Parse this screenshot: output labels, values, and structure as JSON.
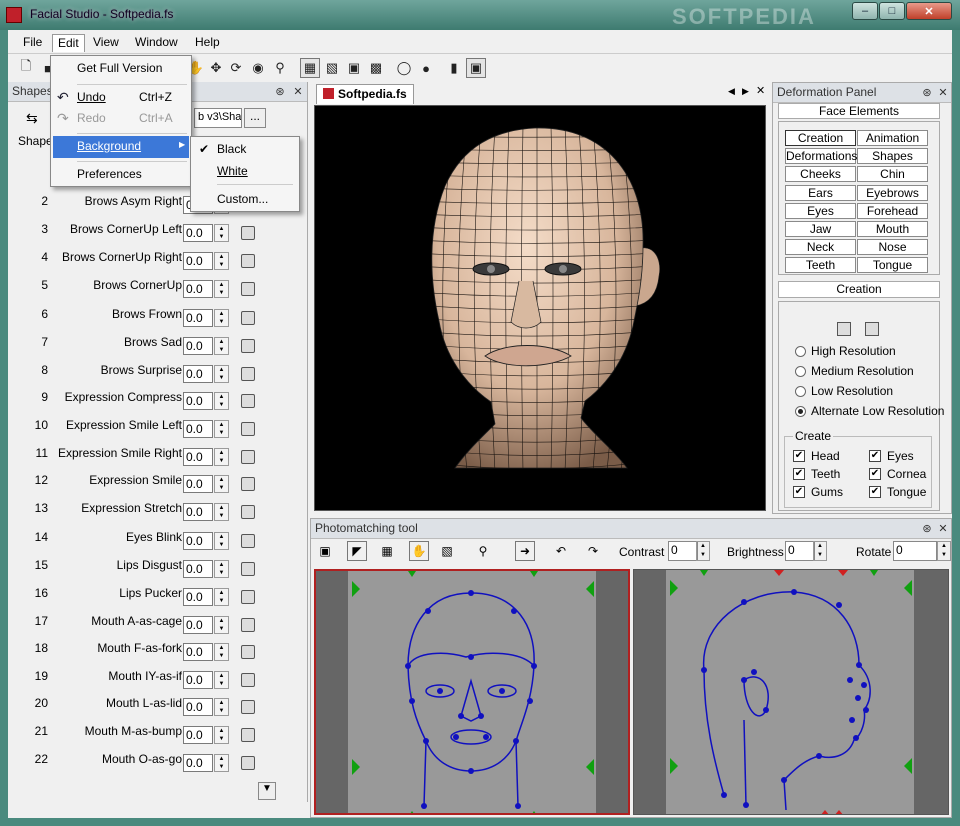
{
  "window": {
    "title": "Facial Studio - Softpedia.fs",
    "watermark": "SOFTPEDIA"
  },
  "menubar": [
    "File",
    "Edit",
    "View",
    "Window",
    "Help"
  ],
  "edit_menu": {
    "items": [
      {
        "label": "Get Full Version",
        "shortcut": "",
        "enabled": true
      },
      {
        "label": "Undo",
        "shortcut": "Ctrl+Z",
        "enabled": true
      },
      {
        "label": "Redo",
        "shortcut": "Ctrl+A",
        "enabled": false
      },
      {
        "label": "Background",
        "shortcut": "",
        "enabled": true,
        "highlighted": true
      },
      {
        "label": "Preferences",
        "shortcut": "",
        "enabled": true
      }
    ],
    "background_submenu": [
      {
        "label": "Black",
        "checked": true
      },
      {
        "label": "White",
        "checked": false
      },
      {
        "label": "Custom...",
        "checked": false
      }
    ]
  },
  "shapes_panel": {
    "title": "Shapes",
    "shape_label": "Shape",
    "path_value": "b v3\\Sha",
    "browse_label": "...",
    "rows": [
      {
        "num": "2",
        "name": "Brows Asym Right",
        "value": "0.0"
      },
      {
        "num": "3",
        "name": "Brows CornerUp Left",
        "value": "0.0"
      },
      {
        "num": "4",
        "name": "Brows CornerUp Right",
        "value": "0.0"
      },
      {
        "num": "5",
        "name": "Brows CornerUp",
        "value": "0.0"
      },
      {
        "num": "6",
        "name": "Brows Frown",
        "value": "0.0"
      },
      {
        "num": "7",
        "name": "Brows Sad",
        "value": "0.0"
      },
      {
        "num": "8",
        "name": "Brows Surprise",
        "value": "0.0"
      },
      {
        "num": "9",
        "name": "Expression Compress",
        "value": "0.0"
      },
      {
        "num": "10",
        "name": "Expression Smile Left",
        "value": "0.0"
      },
      {
        "num": "11",
        "name": "Expression Smile Right",
        "value": "0.0"
      },
      {
        "num": "12",
        "name": "Expression Smile",
        "value": "0.0"
      },
      {
        "num": "13",
        "name": "Expression Stretch",
        "value": "0.0"
      },
      {
        "num": "14",
        "name": "Eyes Blink",
        "value": "0.0"
      },
      {
        "num": "15",
        "name": "Lips Disgust",
        "value": "0.0"
      },
      {
        "num": "16",
        "name": "Lips Pucker",
        "value": "0.0"
      },
      {
        "num": "17",
        "name": "Mouth A-as-cage",
        "value": "0.0"
      },
      {
        "num": "18",
        "name": "Mouth F-as-fork",
        "value": "0.0"
      },
      {
        "num": "19",
        "name": "Mouth IY-as-if",
        "value": "0.0"
      },
      {
        "num": "20",
        "name": "Mouth L-as-lid",
        "value": "0.0"
      },
      {
        "num": "21",
        "name": "Mouth M-as-bump",
        "value": "0.0"
      },
      {
        "num": "22",
        "name": "Mouth O-as-go",
        "value": "0.0"
      }
    ]
  },
  "viewport": {
    "tab": "Softpedia.fs",
    "skin_color": "#e8c8b0",
    "background": "#000000"
  },
  "deformation_panel": {
    "title": "Deformation Panel",
    "face_elements_label": "Face Elements",
    "buttons": [
      "Creation",
      "Animation",
      "Deformations",
      "Shapes",
      "Cheeks",
      "Chin",
      "Ears",
      "Eyebrows",
      "Eyes",
      "Forehead",
      "Jaw",
      "Mouth",
      "Neck",
      "Nose",
      "Teeth",
      "Tongue"
    ],
    "creation_label": "Creation",
    "resolutions": [
      {
        "label": "High Resolution",
        "selected": false
      },
      {
        "label": "Medium Resolution",
        "selected": false
      },
      {
        "label": "Low Resolution",
        "selected": false
      },
      {
        "label": "Alternate Low Resolution",
        "selected": true
      }
    ],
    "create_label": "Create",
    "create_items": [
      {
        "label": "Head",
        "checked": true
      },
      {
        "label": "Eyes",
        "checked": true
      },
      {
        "label": "Teeth",
        "checked": true
      },
      {
        "label": "Cornea",
        "checked": true
      },
      {
        "label": "Gums",
        "checked": true
      },
      {
        "label": "Tongue",
        "checked": true
      }
    ]
  },
  "photomatching": {
    "title": "Photomatching tool",
    "contrast_label": "Contrast",
    "contrast_value": "0",
    "brightness_label": "Brightness",
    "brightness_value": "0",
    "rotate_label": "Rotate",
    "rotate_value": "0",
    "wire_color": "#1010c0"
  }
}
